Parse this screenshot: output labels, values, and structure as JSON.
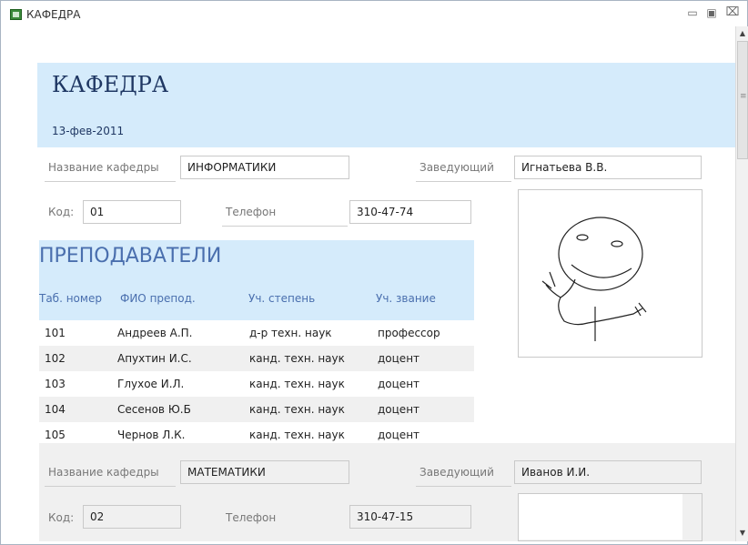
{
  "window": {
    "title": "КАФЕДРА",
    "controls": [
      "minimize",
      "maximize",
      "close"
    ]
  },
  "report": {
    "title": "КАФЕДРА",
    "date": "13-фев-2011"
  },
  "labels": {
    "dept_name": "Название кафедры",
    "head": "Заведующий",
    "code": "Код:",
    "phone": "Телефон"
  },
  "dept1": {
    "name": "ИНФОРМАТИКИ",
    "head": "Игнатьева В.В.",
    "code": "01",
    "phone": "310-47-74"
  },
  "teachers": {
    "title": "ПРЕПОДАВАТЕЛИ",
    "columns": [
      "Таб. номер",
      "ФИО препод.",
      "Уч. степень",
      "Уч. звание"
    ],
    "rows": [
      {
        "id": "101",
        "name": "Андреев А.П.",
        "degree": "д-р техн. наук",
        "rank": "профессор"
      },
      {
        "id": "102",
        "name": "Апухтин И.С.",
        "degree": "канд. техн. наук",
        "rank": "доцент"
      },
      {
        "id": "103",
        "name": "Глухое И.Л.",
        "degree": "канд. техн. наук",
        "rank": "доцент"
      },
      {
        "id": "104",
        "name": "Сесенов Ю.Б",
        "degree": "канд. техн. наук",
        "rank": "доцент"
      },
      {
        "id": "105",
        "name": "Чернов Л.К.",
        "degree": "канд. техн. наук",
        "rank": "доцент"
      }
    ]
  },
  "dept2": {
    "name": "МАТЕМАТИКИ",
    "head": "Иванов И.И.",
    "code": "02",
    "phone": "310-47-15"
  },
  "icons": {
    "app": "form-icon",
    "minimize": "minimize-icon",
    "maximize": "maximize-icon",
    "close": "close-icon",
    "scroll_up": "scroll-up-arrow-icon",
    "scroll_down": "scroll-down-arrow-icon"
  }
}
